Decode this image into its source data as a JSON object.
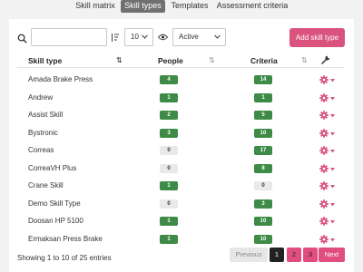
{
  "tabs": [
    {
      "label": "Skill matrix"
    },
    {
      "label": "Skill types"
    },
    {
      "label": "Templates"
    },
    {
      "label": "Assessment criteria"
    }
  ],
  "toolbar": {
    "search_value": "",
    "page_size": "10",
    "status_filter": "Active",
    "add_label": "Add skill type"
  },
  "table": {
    "columns": [
      "Skill type",
      "People",
      "Criteria"
    ],
    "rows": [
      {
        "name": "Amada Brake Press",
        "people": "4",
        "criteria": "14",
        "people_zero": false,
        "criteria_zero": false
      },
      {
        "name": "Andrew",
        "people": "1",
        "criteria": "1",
        "people_zero": false,
        "criteria_zero": false
      },
      {
        "name": "Assist Skill",
        "people": "2",
        "criteria": "5",
        "people_zero": false,
        "criteria_zero": false
      },
      {
        "name": "Bystronic",
        "people": "3",
        "criteria": "10",
        "people_zero": false,
        "criteria_zero": false
      },
      {
        "name": "Correas",
        "people": "0",
        "criteria": "17",
        "people_zero": true,
        "criteria_zero": false
      },
      {
        "name": "CorreaVH Plus",
        "people": "0",
        "criteria": "8",
        "people_zero": true,
        "criteria_zero": false
      },
      {
        "name": "Crane Skill",
        "people": "1",
        "criteria": "0",
        "people_zero": false,
        "criteria_zero": true
      },
      {
        "name": "Demo Skill Type",
        "people": "0",
        "criteria": "3",
        "people_zero": true,
        "criteria_zero": false
      },
      {
        "name": "Doosan HP 5100",
        "people": "1",
        "criteria": "10",
        "people_zero": false,
        "criteria_zero": false
      },
      {
        "name": "Ermaksan Press Brake",
        "people": "1",
        "criteria": "10",
        "people_zero": false,
        "criteria_zero": false
      }
    ]
  },
  "footer": {
    "info": "Showing 1 to 10 of 25 entries",
    "prev_label": "Previous",
    "pages": [
      "1",
      "2",
      "3"
    ],
    "next_label": "Next"
  },
  "colors": {
    "accent": "#d9537e",
    "badge_green": "#3d8b46",
    "badge_gray": "#e9e9e9",
    "gear": "#d9537e"
  },
  "icons": [
    "search-icon",
    "sort-icon",
    "eye-icon",
    "wrench-icon",
    "gear-icon",
    "chevron-down-icon"
  ]
}
